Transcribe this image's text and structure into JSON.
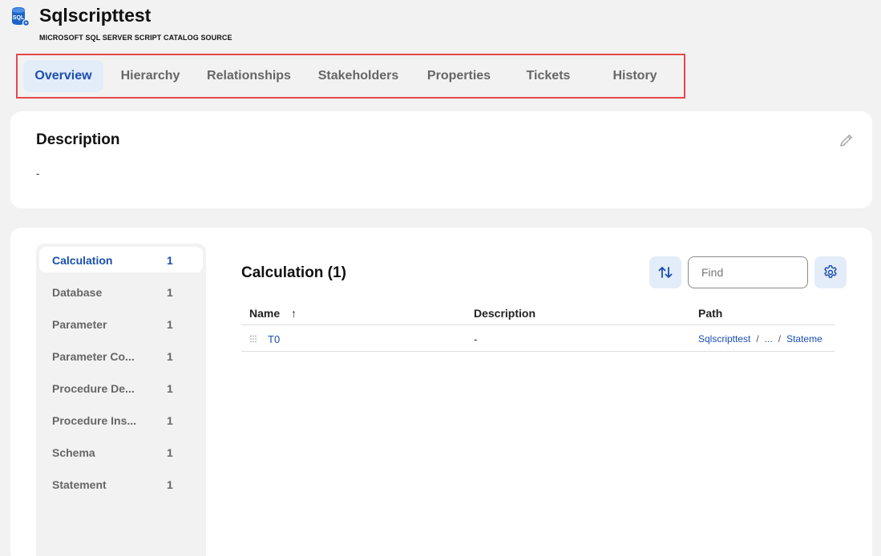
{
  "header": {
    "icon": "sql-database-icon",
    "title": "Sqlscripttest",
    "subtitle": "MICROSOFT SQL SERVER SCRIPT CATALOG SOURCE"
  },
  "tabs": [
    {
      "label": "Overview",
      "active": true
    },
    {
      "label": "Hierarchy"
    },
    {
      "label": "Relationships"
    },
    {
      "label": "Stakeholders"
    },
    {
      "label": "Properties"
    },
    {
      "label": "Tickets"
    },
    {
      "label": "History"
    }
  ],
  "description": {
    "title": "Description",
    "value": "-",
    "edit_icon": "pencil-icon"
  },
  "sidebar": {
    "items": [
      {
        "label": "Calculation",
        "count": "1",
        "active": true
      },
      {
        "label": "Database",
        "count": "1"
      },
      {
        "label": "Parameter",
        "count": "1"
      },
      {
        "label": "Parameter Co...",
        "count": "1"
      },
      {
        "label": "Procedure De...",
        "count": "1"
      },
      {
        "label": "Procedure Ins...",
        "count": "1"
      },
      {
        "label": "Schema",
        "count": "1"
      },
      {
        "label": "Statement",
        "count": "1"
      }
    ]
  },
  "content": {
    "title": "Calculation (1)",
    "sort_icon": "sort-arrows-icon",
    "find_placeholder": "Find",
    "settings_icon": "gear-icon"
  },
  "table": {
    "columns": {
      "name": "Name",
      "name_sort": "↑",
      "description": "Description",
      "path": "Path"
    },
    "rows": [
      {
        "name": "T0",
        "description": "-",
        "path": [
          "Sqlscripttest",
          "...",
          "Stateme"
        ],
        "path_sep": "/"
      }
    ]
  },
  "colors": {
    "accent": "#1a4eb0",
    "accent_bg": "#e3ecf9",
    "highlight_border": "#e5484d"
  }
}
